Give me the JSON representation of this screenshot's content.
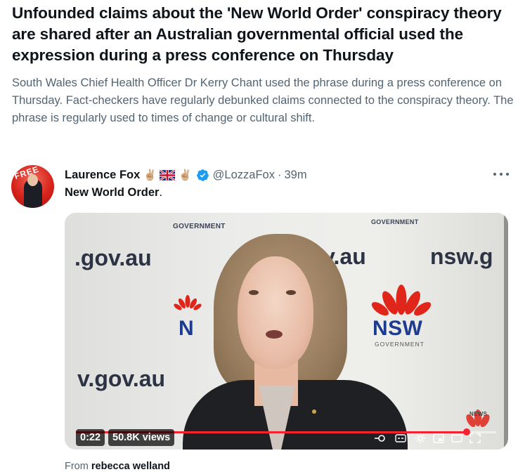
{
  "article": {
    "headline": "Unfounded claims about the 'New World Order' conspiracy theory are shared after an Australian governmental official used the expression during a press conference on Thursday",
    "summary": "South Wales Chief Health Officer Dr Kerry Chant used the phrase during a press conference on Thursday. Fact-checkers have regularly debunked claims connected to the conspiracy theory. The phrase is regularly used to times of change or cultural shift."
  },
  "tweet": {
    "author_name": "Laurence Fox",
    "author_emoji_before": "✌🏼",
    "author_emoji_after": "✌🏼",
    "flag_icon": "uk-flag-icon",
    "handle": "@LozzaFox",
    "separator": "·",
    "time": "39m",
    "text_bold": "New World Order",
    "text_tail": ".",
    "avatar_badge": "FREE"
  },
  "video": {
    "backdrop_texts": {
      "gov_left": ".gov.au",
      "gov_mid": "gov.au",
      "nsw_right": "nsw.g",
      "gov_lower": "v.gov.au",
      "government_top_left": "GOVERNMENT",
      "government_top_right": "GOVERNMENT",
      "nsw_word": "NSW",
      "nsw_gov": "GOVERNMENT",
      "nsw_left_partial": "N",
      "news_corner": "NEWS"
    },
    "elapsed": "0:22",
    "views": "50.8K views",
    "progress": 0.93
  },
  "source": {
    "prefix": "From",
    "name": "rebecca welland"
  },
  "colors": {
    "progress": "#f4212e",
    "verified": "#1d9bf0",
    "nsw_blue": "#1d3b8f",
    "waratah_red": "#e0251b",
    "secondary_text": "#536471"
  }
}
